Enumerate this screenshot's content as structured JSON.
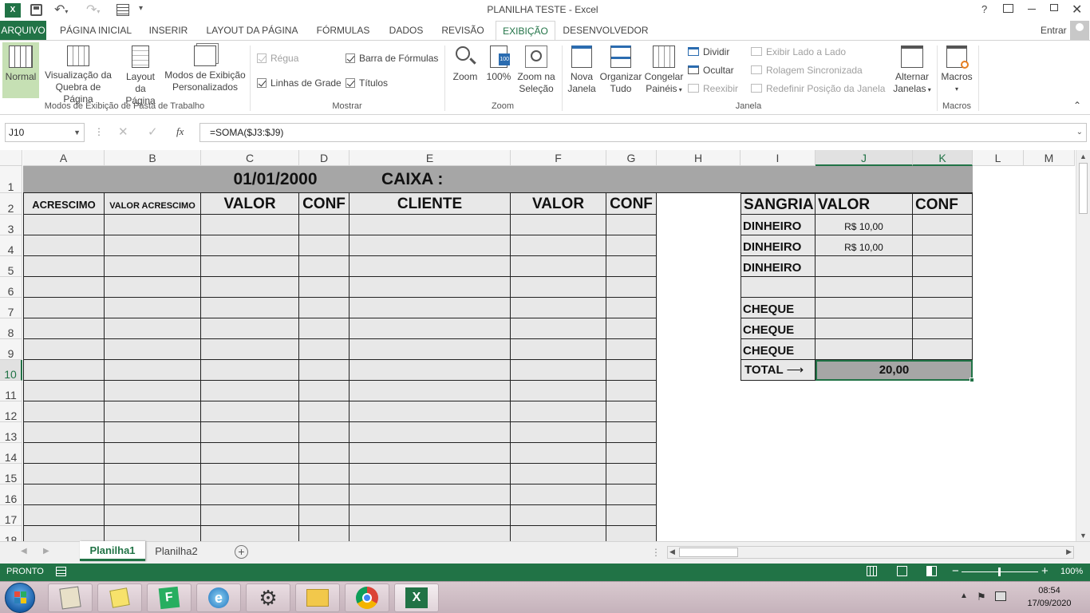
{
  "window": {
    "title": "PLANILHA TESTE - Excel",
    "help": "?",
    "signin": "Entrar"
  },
  "tabs": {
    "file": "ARQUIVO",
    "items": [
      "PÁGINA INICIAL",
      "INSERIR",
      "LAYOUT DA PÁGINA",
      "FÓRMULAS",
      "DADOS",
      "REVISÃO",
      "EXIBIÇÃO",
      "DESENVOLVEDOR"
    ],
    "active": "EXIBIÇÃO"
  },
  "ribbon": {
    "views": {
      "normal": "Normal",
      "page_break_1": "Visualização da",
      "page_break_2": "Quebra de Página",
      "layout_1": "Layout",
      "layout_2": "da Página",
      "custom_1": "Modos de Exibição",
      "custom_2": "Personalizados",
      "label": "Modos de Exibição de Pasta de Trabalho"
    },
    "show": {
      "ruler": "Régua",
      "formula_bar": "Barra de Fórmulas",
      "gridlines": "Linhas de Grade",
      "headings": "Títulos",
      "label": "Mostrar"
    },
    "zoom": {
      "zoom": "Zoom",
      "hundred": "100%",
      "sel_1": "Zoom na",
      "sel_2": "Seleção",
      "label": "Zoom"
    },
    "window": {
      "new_1": "Nova",
      "new_2": "Janela",
      "arrange_1": "Organizar",
      "arrange_2": "Tudo",
      "freeze_1": "Congelar",
      "freeze_2": "Painéis",
      "split": "Dividir",
      "hide": "Ocultar",
      "unhide": "Reexibir",
      "side": "Exibir Lado a Lado",
      "sync": "Rolagem Sincronizada",
      "reset": "Redefinir Posição da Janela",
      "switch_1": "Alternar",
      "switch_2": "Janelas",
      "label": "Janela"
    },
    "macros": {
      "macros": "Macros",
      "label": "Macros"
    }
  },
  "formula_bar": {
    "name_box": "J10",
    "fx": "fx",
    "formula": "=SOMA($J3:$J9)"
  },
  "columns": [
    "A",
    "B",
    "C",
    "D",
    "E",
    "F",
    "G",
    "H",
    "I",
    "J",
    "K",
    "L",
    "M"
  ],
  "rows": [
    "1",
    "2",
    "3",
    "4",
    "5",
    "6",
    "7",
    "8",
    "9",
    "10",
    "11",
    "12",
    "13",
    "14",
    "15",
    "16",
    "17",
    "18"
  ],
  "sheet": {
    "date": "01/01/2000",
    "caixa": "CAIXA :",
    "headers": [
      "ACRESCIMO",
      "VALOR ACRESCIMO",
      "VALOR",
      "CONF",
      "CLIENTE",
      "VALOR",
      "CONF"
    ],
    "sangria_headers": [
      "SANGRIA",
      "VALOR",
      "CONF"
    ],
    "sangria_rows": [
      {
        "label": "DINHEIRO",
        "value": "R$ 10,00"
      },
      {
        "label": "DINHEIRO",
        "value": "R$ 10,00"
      },
      {
        "label": "DINHEIRO",
        "value": ""
      },
      {
        "label": "",
        "value": ""
      },
      {
        "label": "CHEQUE",
        "value": ""
      },
      {
        "label": "CHEQUE",
        "value": ""
      },
      {
        "label": "CHEQUE",
        "value": ""
      }
    ],
    "total_label": "TOTAL",
    "total_value": "20,00"
  },
  "sheet_tabs": [
    "Planilha1",
    "Planilha2"
  ],
  "status": {
    "ready": "PRONTO",
    "zoom": "100%"
  },
  "taskbar": {
    "time": "08:54",
    "date": "17/09/2020"
  },
  "colors": {
    "excel_green": "#217346",
    "cell_fill": "#e8e8e8",
    "header_fill": "#a6a6a6"
  }
}
